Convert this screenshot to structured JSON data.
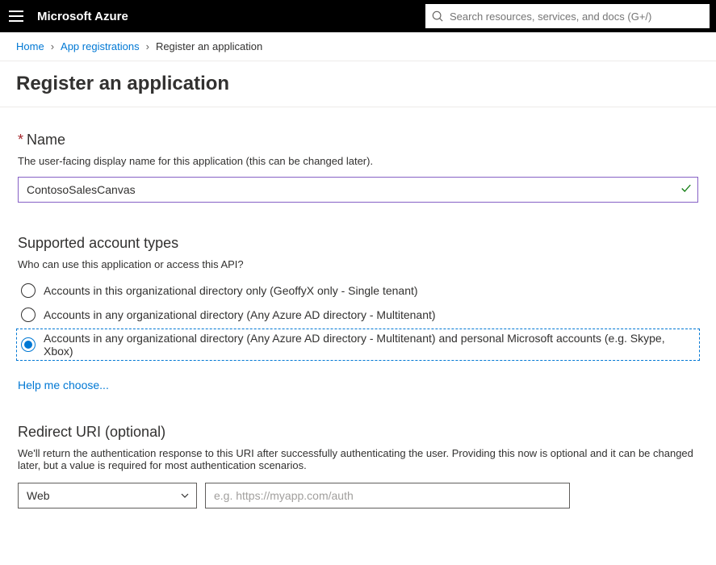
{
  "header": {
    "brand": "Microsoft Azure",
    "search_placeholder": "Search resources, services, and docs (G+/)"
  },
  "breadcrumb": {
    "home": "Home",
    "appreg": "App registrations",
    "current": "Register an application"
  },
  "page_title": "Register an application",
  "name_section": {
    "label": "Name",
    "description": "The user-facing display name for this application (this can be changed later).",
    "value": "ContosoSalesCanvas"
  },
  "account_section": {
    "title": "Supported account types",
    "description": "Who can use this application or access this API?",
    "options": {
      "o1": "Accounts in this organizational directory only (GeoffyX only - Single tenant)",
      "o2": "Accounts in any organizational directory (Any Azure AD directory - Multitenant)",
      "o3": "Accounts in any organizational directory (Any Azure AD directory - Multitenant) and personal Microsoft accounts (e.g. Skype, Xbox)"
    },
    "help_link": "Help me choose..."
  },
  "redirect_section": {
    "title": "Redirect URI (optional)",
    "description": "We'll return the authentication response to this URI after successfully authenticating the user. Providing this now is optional and it can be changed later, but a value is required for most authentication scenarios.",
    "platform_value": "Web",
    "uri_placeholder": "e.g. https://myapp.com/auth"
  }
}
